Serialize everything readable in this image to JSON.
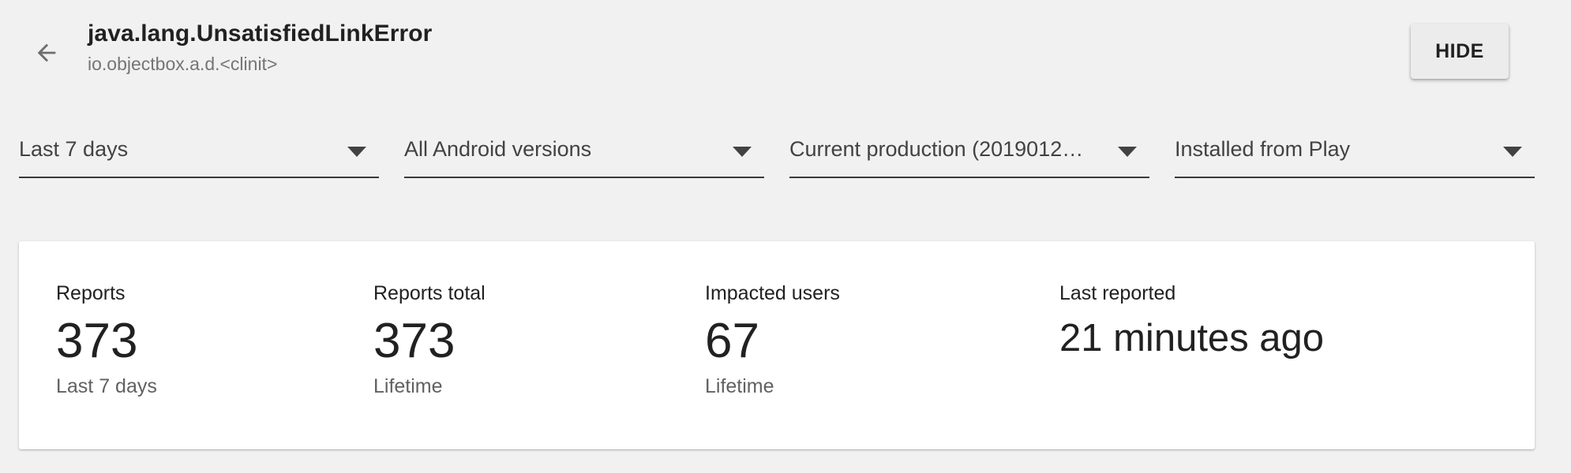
{
  "header": {
    "title": "java.lang.UnsatisfiedLinkError",
    "subtitle": "io.objectbox.a.d.<clinit>",
    "hide_label": "HIDE",
    "back_icon": "arrow-back-icon"
  },
  "filters": [
    {
      "label": "Last 7 days",
      "icon": "dropdown-arrow-icon"
    },
    {
      "label": "All Android versions",
      "icon": "dropdown-arrow-icon"
    },
    {
      "label": "Current production (2019012…",
      "icon": "dropdown-arrow-icon"
    },
    {
      "label": "Installed from Play",
      "icon": "dropdown-arrow-icon"
    }
  ],
  "stats": [
    {
      "label": "Reports",
      "value": "373",
      "sub": "Last 7 days"
    },
    {
      "label": "Reports total",
      "value": "373",
      "sub": "Lifetime"
    },
    {
      "label": "Impacted users",
      "value": "67",
      "sub": "Lifetime"
    },
    {
      "label": "Last reported",
      "value": "21 minutes ago",
      "sub": ""
    }
  ],
  "colors": {
    "background": "#f1f1f1",
    "card": "#ffffff",
    "text_primary": "#212121",
    "text_secondary": "#757575"
  }
}
